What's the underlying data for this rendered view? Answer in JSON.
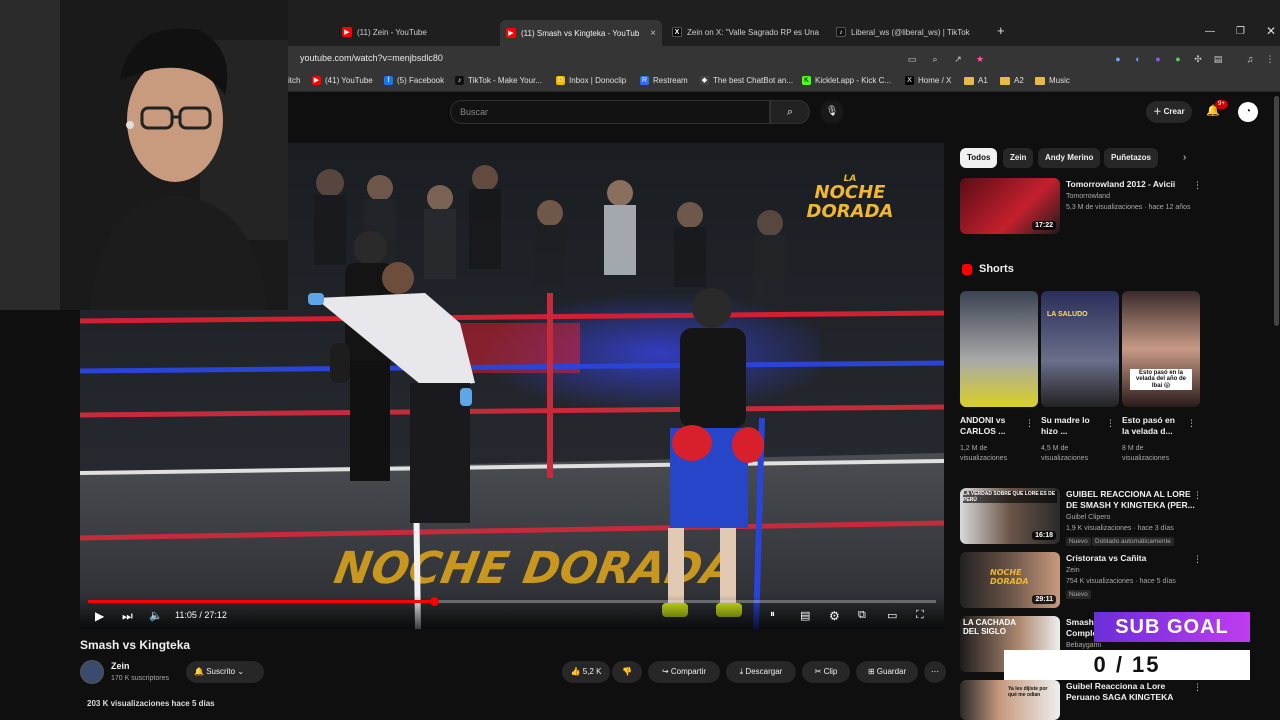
{
  "browser": {
    "tabs": [
      {
        "title": "(11) Zein - YouTube",
        "favicon": "youtube"
      },
      {
        "title": "(11) Smash vs Kingteka - YouTube",
        "favicon": "youtube",
        "active": true
      },
      {
        "title": "Zein on X: \"Valle Sagrado RP es Una",
        "favicon": "x"
      },
      {
        "title": "Liberal_ws (@liberal_ws) | TikTok",
        "favicon": "tiktok"
      }
    ],
    "url": "youtube.com/watch?v=menjbsdlc80",
    "bookmarks": [
      {
        "label": "itch",
        "icon": "twitch"
      },
      {
        "label": "(41) YouTube",
        "icon": "youtube"
      },
      {
        "label": "(5) Facebook",
        "icon": "facebook"
      },
      {
        "label": "TikTok - Make Your...",
        "icon": "tiktok"
      },
      {
        "label": "Inbox | Donoclip",
        "icon": "donoclip"
      },
      {
        "label": "Restream",
        "icon": "restream"
      },
      {
        "label": "The best ChatBot an...",
        "icon": "chatbot"
      },
      {
        "label": "Kicklet.app - Kick C...",
        "icon": "kicklet"
      },
      {
        "label": "Home / X",
        "icon": "x"
      },
      {
        "label": "A1",
        "icon": "folder"
      },
      {
        "label": "A2",
        "icon": "folder"
      },
      {
        "label": "Music",
        "icon": "folder"
      }
    ]
  },
  "header": {
    "search_placeholder": "Buscar",
    "create_label": "Crear",
    "notifications": "9+"
  },
  "player": {
    "time": "11:05 / 27:12",
    "progress": 0.4075,
    "logo_line1": "LA",
    "logo_line2": "NOCHE",
    "logo_line3": "DORADA",
    "canvas_text": "NOCHE DORADA"
  },
  "video": {
    "title": "Smash vs Kingteka",
    "channel": "Zein",
    "subscribers": "170 K suscriptores",
    "subscribe_label": "Suscrito",
    "likes": "5,2 K",
    "share": "Compartir",
    "download": "Descargar",
    "clip": "Clip",
    "save": "Guardar",
    "views": "203 K visualizaciones  hace 5 días"
  },
  "sidebar": {
    "chips": [
      "Todos",
      "Zein",
      "Andy Merino",
      "Puñetazos"
    ],
    "top_video": {
      "title": "Tomorrowland 2012 - Avicii",
      "channel": "Tomorrowland",
      "meta": "5,3 M de visualizaciones · hace 12 años",
      "duration": "17:22"
    },
    "shorts_title": "Shorts",
    "shorts": [
      {
        "title1": "ANDONI vs",
        "title2": "CARLOS ...",
        "views1": "1,2 M de",
        "views2": "visualizaciones"
      },
      {
        "title1": "Su madre lo",
        "title2": "hizo ...",
        "views1": "4,5 M de",
        "views2": "visualizaciones",
        "overlay": "LA SALUDO"
      },
      {
        "title1": "Esto pasó en",
        "title2": "la velada d...",
        "views1": "8 M de",
        "views2": "visualizaciones",
        "overlay": "Esto pasó en la velada del año de Ibai 😱"
      }
    ],
    "videos": [
      {
        "title1": "GUIBEL REACCIONA AL LORE",
        "title2": "DE SMASH Y KINGTEKA (PER...",
        "channel": "Guibel Clipero",
        "meta": "1,9 K visualizaciones · hace 3 días",
        "badge1": "Nuevo",
        "badge2": "Doblado automáticamente",
        "duration": "16:18",
        "overlay": "LA VERDAD SOBRE QUE LORE ES DE PERÚ"
      },
      {
        "title1": "Cristorata vs Cañita",
        "title2": "",
        "channel": "Zein",
        "meta": "754 K visualizaciones · hace 5 días",
        "badge1": "Nuevo",
        "duration": "29:11",
        "overlay": "NOCHE DORADA"
      },
      {
        "title1": "Smash",
        "title2": "Comple",
        "channel": "Bebaygami",
        "meta": "",
        "overlay": "LA CACHADA DEL SIGLO"
      },
      {
        "title1": "Guibel Reacciona a Lore",
        "title2": "Peruano SAGA KINGTEKA",
        "channel": "",
        "meta": "",
        "overlay": "Ya les dijiste por qué me odian"
      }
    ]
  },
  "overlay": {
    "subgoal": "SUB GOAL",
    "count": "0 / 15"
  }
}
